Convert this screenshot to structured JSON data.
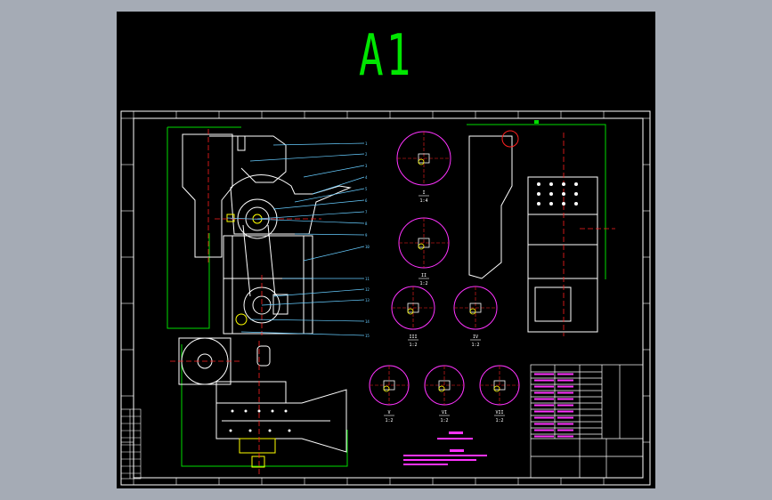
{
  "sheet": {
    "size_label": "A1"
  },
  "colors": {
    "background_page": "#a5abb5",
    "viewport": "#000000",
    "title": "#00e600",
    "frame": "#ffffff",
    "outline_green": "#00dd00",
    "center_red": "#ff2020",
    "leader_cyan": "#66ccff",
    "detail_magenta": "#ff33ff",
    "highlight_yellow": "#ffff00"
  },
  "detail_views": [
    {
      "id": "detail-1",
      "label": "I",
      "scale": "1:4"
    },
    {
      "id": "detail-2",
      "label": "II",
      "scale": "1:2"
    },
    {
      "id": "detail-3",
      "label": "III",
      "scale": "1:2"
    },
    {
      "id": "detail-4",
      "label": "IV",
      "scale": "1:2"
    },
    {
      "id": "detail-5",
      "label": "V",
      "scale": "1:2"
    },
    {
      "id": "detail-6",
      "label": "VI",
      "scale": "1:2"
    },
    {
      "id": "detail-7",
      "label": "VII",
      "scale": "1:2"
    }
  ],
  "balloons": [
    "1",
    "2",
    "3",
    "4",
    "5",
    "6",
    "7",
    "8",
    "9",
    "10",
    "11",
    "12",
    "13",
    "14",
    "15"
  ],
  "icons": {
    "green_marker": "square-marker-icon"
  }
}
